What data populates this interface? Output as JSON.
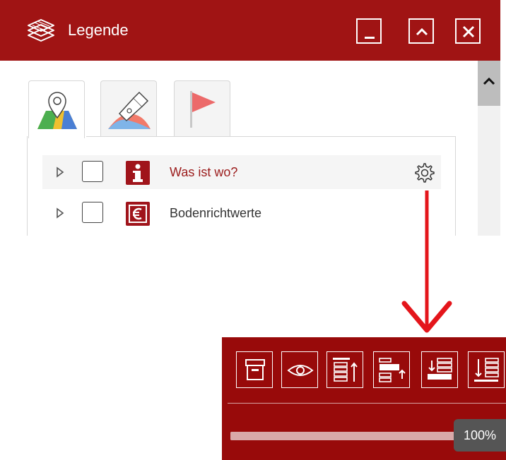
{
  "window": {
    "title": "Legende",
    "accent_color": "#a01414",
    "controls": {
      "minimize": "minimize-icon",
      "maximize": "chevron-up-icon",
      "close": "close-icon"
    }
  },
  "tabs": [
    {
      "icon": "map-pin-icon",
      "active": true
    },
    {
      "icon": "pen-nib-icon",
      "active": false
    },
    {
      "icon": "flag-icon",
      "active": false
    }
  ],
  "layers": [
    {
      "label": "Was ist wo?",
      "icon": "info-icon",
      "checked": false,
      "hover": true,
      "action_icon": "gear-icon"
    },
    {
      "label": "Bodenrichtwerte",
      "icon": "euro-icon",
      "checked": false,
      "hover": false
    }
  ],
  "annotation": {
    "icon": "arrow-down-icon",
    "color": "#e4151b"
  },
  "toolbar": {
    "buttons": [
      "archive-icon",
      "eye-icon",
      "move-top-icon",
      "move-up-icon",
      "move-down-icon",
      "move-bottom-icon"
    ],
    "opacity": {
      "value": 1.0,
      "label": "100%"
    }
  }
}
